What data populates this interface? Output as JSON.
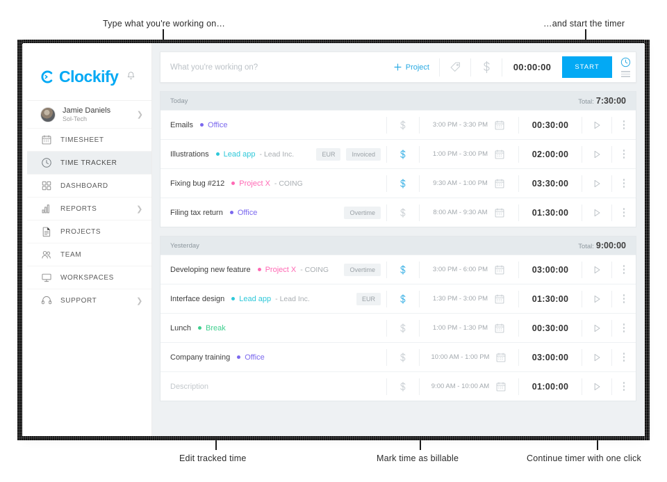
{
  "annotations": {
    "top_left": "Type what you're working on…",
    "top_right": "…and start the timer",
    "bottom_left": "Edit tracked time",
    "bottom_center": "Mark time as billable",
    "bottom_right": "Continue timer with one click"
  },
  "brand": {
    "name": "Clockify",
    "logo_icon": "clockify-logo-icon",
    "bell_icon": "bell-icon",
    "accent": "#03A9F4"
  },
  "sidebar": {
    "user": {
      "name": "Jamie Daniels",
      "workspace": "Sol-Tech",
      "avatar_icon": "avatar",
      "chevron_icon": "chevron-right-icon"
    },
    "items": [
      {
        "label": "TIMESHEET",
        "icon": "calendar-icon",
        "active": false,
        "chevron": false
      },
      {
        "label": "TIME TRACKER",
        "icon": "clock-icon",
        "active": true,
        "chevron": false
      },
      {
        "label": "DASHBOARD",
        "icon": "grid-icon",
        "active": false,
        "chevron": false
      },
      {
        "label": "REPORTS",
        "icon": "bar-chart-icon",
        "active": false,
        "chevron": true
      },
      {
        "label": "PROJECTS",
        "icon": "document-icon",
        "active": false,
        "chevron": false
      },
      {
        "label": "TEAM",
        "icon": "people-icon",
        "active": false,
        "chevron": false
      },
      {
        "label": "WORKSPACES",
        "icon": "monitor-icon",
        "active": false,
        "chevron": false
      },
      {
        "label": "SUPPORT",
        "icon": "headset-icon",
        "active": false,
        "chevron": true
      }
    ],
    "color_strip": [
      "#6b7a82",
      "#f6352e",
      "#17a9f3",
      "#f99d1c",
      "#8cc63f",
      "#ec297b",
      "#fdc70c",
      "#9b26b6",
      "#5ab552",
      "#3b5ba9"
    ]
  },
  "timer_bar": {
    "placeholder": "What you're working on?",
    "value": "",
    "project_label": "Project",
    "plus_icon": "plus-icon",
    "tag_icon": "tag-icon",
    "billable_icon": "dollar-icon",
    "duration": "00:00:00",
    "start_label": "START",
    "mode_timer_icon": "clock-icon",
    "mode_manual_icon": "list-icon"
  },
  "groups": [
    {
      "day": "Today",
      "total_label": "Total:",
      "total": "7:30:00",
      "entries": [
        {
          "description": "Emails",
          "project": "Office",
          "project_color": "#7b68ee",
          "client": "",
          "badges": [],
          "billable": false,
          "range": "3:00 PM - 3:30 PM",
          "duration": "00:30:00",
          "calendar_icon": "calendar-icon",
          "play_icon": "play-icon",
          "more_icon": "more-vertical-icon"
        },
        {
          "description": "Illustrations",
          "project": "Lead app",
          "project_color": "#2ec8d9",
          "client": "- Lead Inc.",
          "badges": [
            "EUR",
            "Invoiced"
          ],
          "billable": true,
          "range": "1:00 PM - 3:00 PM",
          "duration": "02:00:00",
          "calendar_icon": "calendar-icon",
          "play_icon": "play-icon",
          "more_icon": "more-vertical-icon"
        },
        {
          "description": "Fixing bug #212",
          "project": "Project X",
          "project_color": "#ff69b4",
          "client": "- COING",
          "badges": [],
          "billable": true,
          "range": "9:30 AM - 1:00 PM",
          "duration": "03:30:00",
          "calendar_icon": "calendar-icon",
          "play_icon": "play-icon",
          "more_icon": "more-vertical-icon"
        },
        {
          "description": "Filing tax return",
          "project": "Office",
          "project_color": "#7b68ee",
          "client": "",
          "badges": [
            "Overtime"
          ],
          "billable": false,
          "range": "8:00 AM - 9:30 AM",
          "duration": "01:30:00",
          "calendar_icon": "calendar-icon",
          "play_icon": "play-icon",
          "more_icon": "more-vertical-icon"
        }
      ]
    },
    {
      "day": "Yesterday",
      "total_label": "Total:",
      "total": "9:00:00",
      "entries": [
        {
          "description": "Developing new feature",
          "project": "Project X",
          "project_color": "#ff69b4",
          "client": "- COING",
          "badges": [
            "Overtime"
          ],
          "billable": true,
          "range": "3:00 PM - 6:00 PM",
          "duration": "03:00:00",
          "calendar_icon": "calendar-icon",
          "play_icon": "play-icon",
          "more_icon": "more-vertical-icon"
        },
        {
          "description": "Interface design",
          "project": "Lead app",
          "project_color": "#2ec8d9",
          "client": "- Lead Inc.",
          "badges": [
            "EUR"
          ],
          "billable": true,
          "range": "1:30 PM - 3:00 PM",
          "duration": "01:30:00",
          "calendar_icon": "calendar-icon",
          "play_icon": "play-icon",
          "more_icon": "more-vertical-icon"
        },
        {
          "description": "Lunch",
          "project": "Break",
          "project_color": "#3ecf8e",
          "client": "",
          "badges": [],
          "billable": false,
          "range": "1:00 PM - 1:30 PM",
          "duration": "00:30:00",
          "calendar_icon": "calendar-icon",
          "play_icon": "play-icon",
          "more_icon": "more-vertical-icon"
        },
        {
          "description": "Company training",
          "project": "Office",
          "project_color": "#7b68ee",
          "client": "",
          "badges": [],
          "billable": false,
          "range": "10:00 AM - 1:00 PM",
          "duration": "03:00:00",
          "calendar_icon": "calendar-icon",
          "play_icon": "play-icon",
          "more_icon": "more-vertical-icon"
        },
        {
          "description": "",
          "placeholder": "Description",
          "project": "",
          "project_color": "",
          "client": "",
          "badges": [],
          "billable": false,
          "range": "9:00 AM - 10:00 AM",
          "duration": "01:00:00",
          "calendar_icon": "calendar-icon",
          "play_icon": "play-icon",
          "more_icon": "more-vertical-icon"
        }
      ]
    }
  ]
}
